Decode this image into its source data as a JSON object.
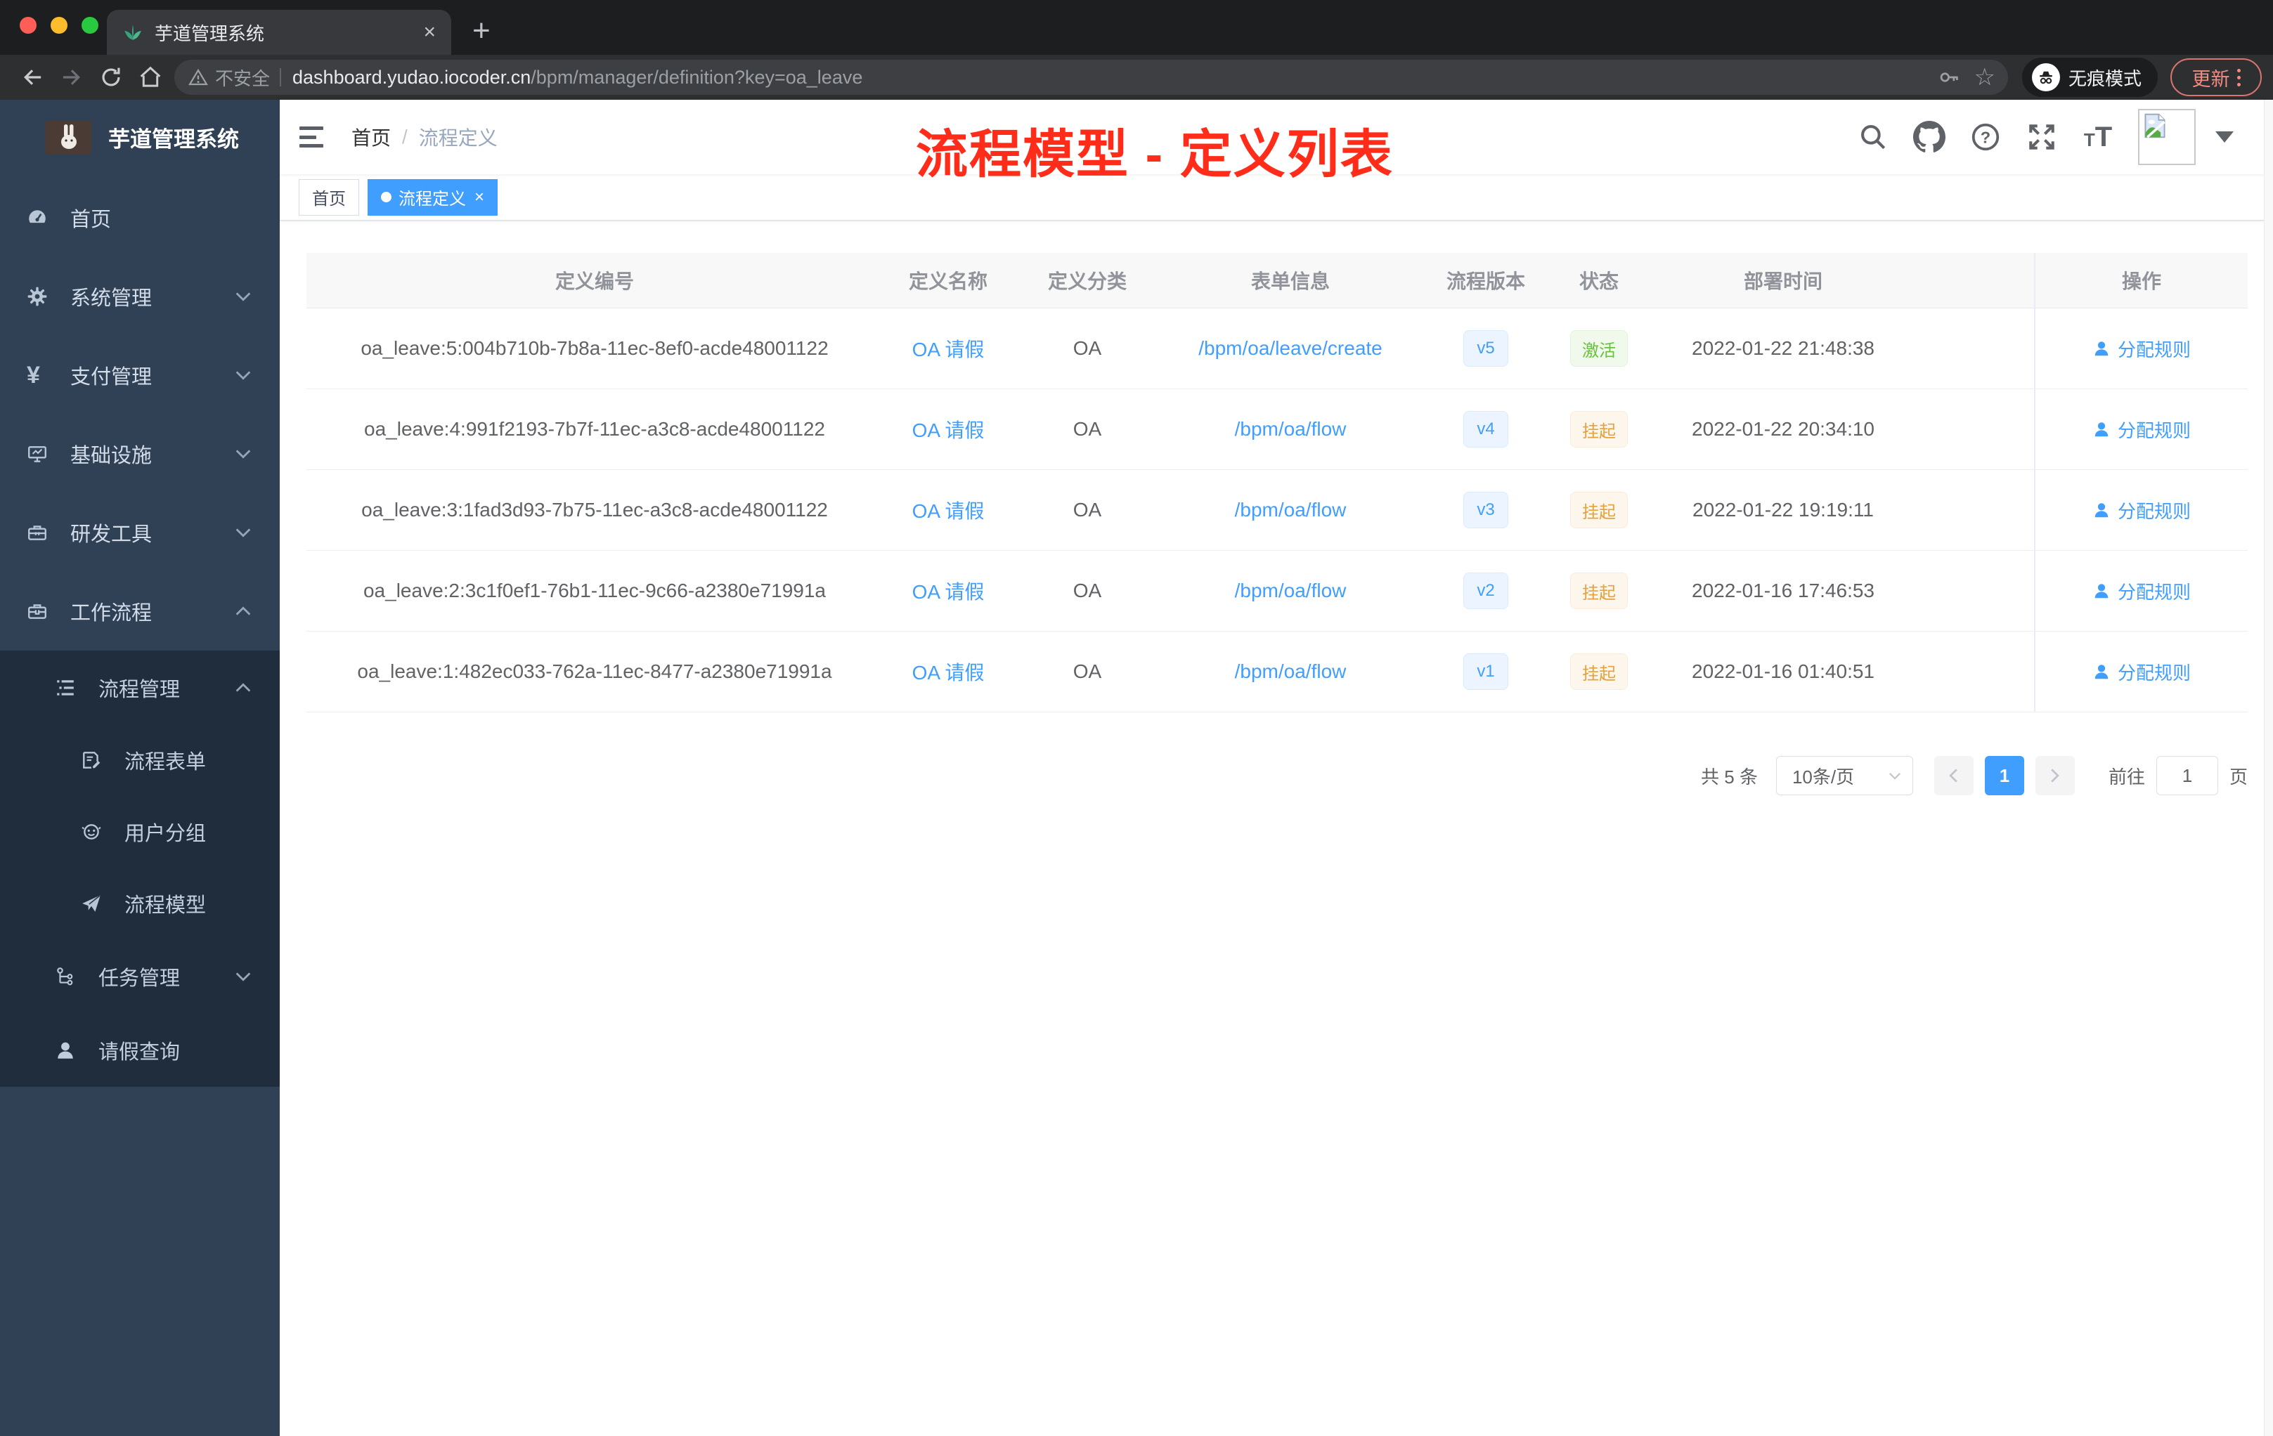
{
  "browser": {
    "tab": {
      "title": "芋道管理系统",
      "close_glyph": "×",
      "new_tab_glyph": "+"
    },
    "address_bar": {
      "security_label": "不安全",
      "url_host": "dashboard.yudao.iocoder.cn",
      "url_path": "/bpm/manager/definition?key=oa_leave",
      "star_glyph": "☆"
    },
    "incognito_label": "无痕模式",
    "update_button": "更新"
  },
  "sidebar": {
    "brand": {
      "title": "芋道管理系统"
    },
    "items": [
      {
        "label": "首页",
        "icon": "dashboard-icon"
      },
      {
        "label": "系统管理",
        "icon": "gear-icon",
        "state": "collapsed"
      },
      {
        "label": "支付管理",
        "icon": "yen-icon",
        "state": "collapsed",
        "icon_glyph": "¥"
      },
      {
        "label": "基础设施",
        "icon": "monitor-icon",
        "state": "collapsed"
      },
      {
        "label": "研发工具",
        "icon": "toolbox-icon",
        "state": "collapsed"
      },
      {
        "label": "工作流程",
        "icon": "briefcase-icon",
        "state": "expanded"
      },
      {
        "label": "流程管理",
        "icon": "list-icon",
        "state": "expanded"
      },
      {
        "label": "流程表单",
        "icon": "form-icon"
      },
      {
        "label": "用户分组",
        "icon": "usergroup-icon"
      },
      {
        "label": "流程模型",
        "icon": "send-icon"
      },
      {
        "label": "任务管理",
        "icon": "tree-icon",
        "state": "collapsed"
      },
      {
        "label": "请假查询",
        "icon": "user-icon"
      }
    ]
  },
  "navbar": {
    "breadcrumb": [
      "首页",
      "流程定义"
    ],
    "breadcrumb_separator": "/",
    "icons": [
      "search-icon",
      "github-icon",
      "help-icon",
      "fullscreen-icon",
      "font-size-icon"
    ],
    "avatar": "broken-image-placeholder"
  },
  "tags": [
    {
      "label": "首页",
      "active": false
    },
    {
      "label": "流程定义",
      "active": true,
      "close_glyph": "×"
    }
  ],
  "annotation": {
    "text": "流程模型 - 定义列表",
    "color": "#fe2c19"
  },
  "table": {
    "columns": [
      "定义编号",
      "定义名称",
      "定义分类",
      "表单信息",
      "流程版本",
      "状态",
      "部署时间",
      "操作"
    ],
    "rows": [
      {
        "id": "oa_leave:5:004b710b-7b8a-11ec-8ef0-acde48001122",
        "name": "OA 请假",
        "category": "OA",
        "form": "/bpm/oa/leave/create",
        "version": "v5",
        "status": {
          "label": "激活",
          "type": "success"
        },
        "time": "2022-01-22 21:48:38",
        "action": "分配规则"
      },
      {
        "id": "oa_leave:4:991f2193-7b7f-11ec-a3c8-acde48001122",
        "name": "OA 请假",
        "category": "OA",
        "form": "/bpm/oa/flow",
        "version": "v4",
        "status": {
          "label": "挂起",
          "type": "warning"
        },
        "time": "2022-01-22 20:34:10",
        "action": "分配规则"
      },
      {
        "id": "oa_leave:3:1fad3d93-7b75-11ec-a3c8-acde48001122",
        "name": "OA 请假",
        "category": "OA",
        "form": "/bpm/oa/flow",
        "version": "v3",
        "status": {
          "label": "挂起",
          "type": "warning"
        },
        "time": "2022-01-22 19:19:11",
        "action": "分配规则"
      },
      {
        "id": "oa_leave:2:3c1f0ef1-76b1-11ec-9c66-a2380e71991a",
        "name": "OA 请假",
        "category": "OA",
        "form": "/bpm/oa/flow",
        "version": "v2",
        "status": {
          "label": "挂起",
          "type": "warning"
        },
        "time": "2022-01-16 17:46:53",
        "action": "分配规则"
      },
      {
        "id": "oa_leave:1:482ec033-762a-11ec-8477-a2380e71991a",
        "name": "OA 请假",
        "category": "OA",
        "form": "/bpm/oa/flow",
        "version": "v1",
        "status": {
          "label": "挂起",
          "type": "warning"
        },
        "time": "2022-01-16 01:40:51",
        "action": "分配规则"
      }
    ]
  },
  "pagination": {
    "total": "共 5 条",
    "page_size": "10条/页",
    "current_page": "1",
    "goto_label": "前往",
    "goto_value": "1",
    "unit_label": "页"
  },
  "colors": {
    "primary": "#409eff",
    "success_text": "#67c23a",
    "success_bg": "#f0f9eb",
    "warning_text": "#e6a23c",
    "warning_bg": "#fdf6ec",
    "sidebar_bg": "#304156",
    "submenu_bg": "#1f2d3d",
    "annotation": "#fe2c19"
  }
}
